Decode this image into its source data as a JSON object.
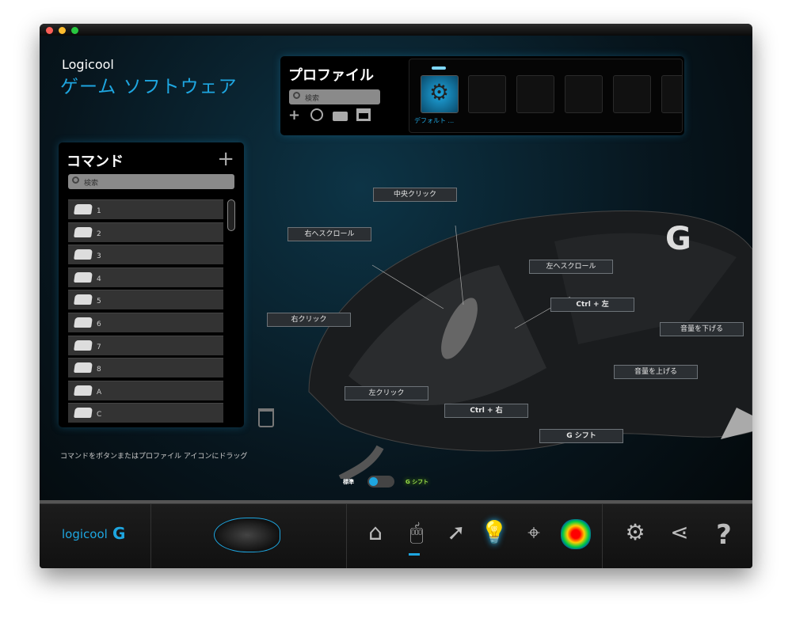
{
  "brand": {
    "line1": "Logicool",
    "line2": "ゲーム ソフトウェア",
    "footer_logo": "logicool"
  },
  "profile": {
    "title": "プロファイル",
    "search_placeholder": "検索",
    "slots": [
      {
        "label": "デフォルト ...",
        "active": true
      },
      {
        "label": ""
      },
      {
        "label": ""
      },
      {
        "label": ""
      },
      {
        "label": ""
      },
      {
        "label": ""
      }
    ],
    "icons": [
      "plus-icon",
      "history-icon",
      "folder-icon",
      "printer-icon"
    ]
  },
  "commands": {
    "title": "コマンド",
    "add": "+",
    "search_placeholder": "検索",
    "items": [
      "1",
      "2",
      "3",
      "4",
      "5",
      "6",
      "7",
      "8",
      "A",
      "C"
    ]
  },
  "labels": {
    "middle": "中央クリック",
    "scroll_right": "右へスクロール",
    "scroll_left": "左へスクロール",
    "ctrl_left": "Ctrl + 左",
    "right_click": "右クリック",
    "vol_down": "音量を下げる",
    "vol_up": "音量を上げる",
    "left_click": "左クリック",
    "ctrl_right": "Ctrl + 右",
    "gshift": "G シフト"
  },
  "hint": "コマンドをボタンまたはプロファイル アイコンにドラッグ",
  "mode": {
    "standard": "標準",
    "gshift": "G シフト",
    "value": "standard"
  },
  "colors": {
    "accent": "#1ea6e0",
    "gshift": "#9be04a"
  }
}
